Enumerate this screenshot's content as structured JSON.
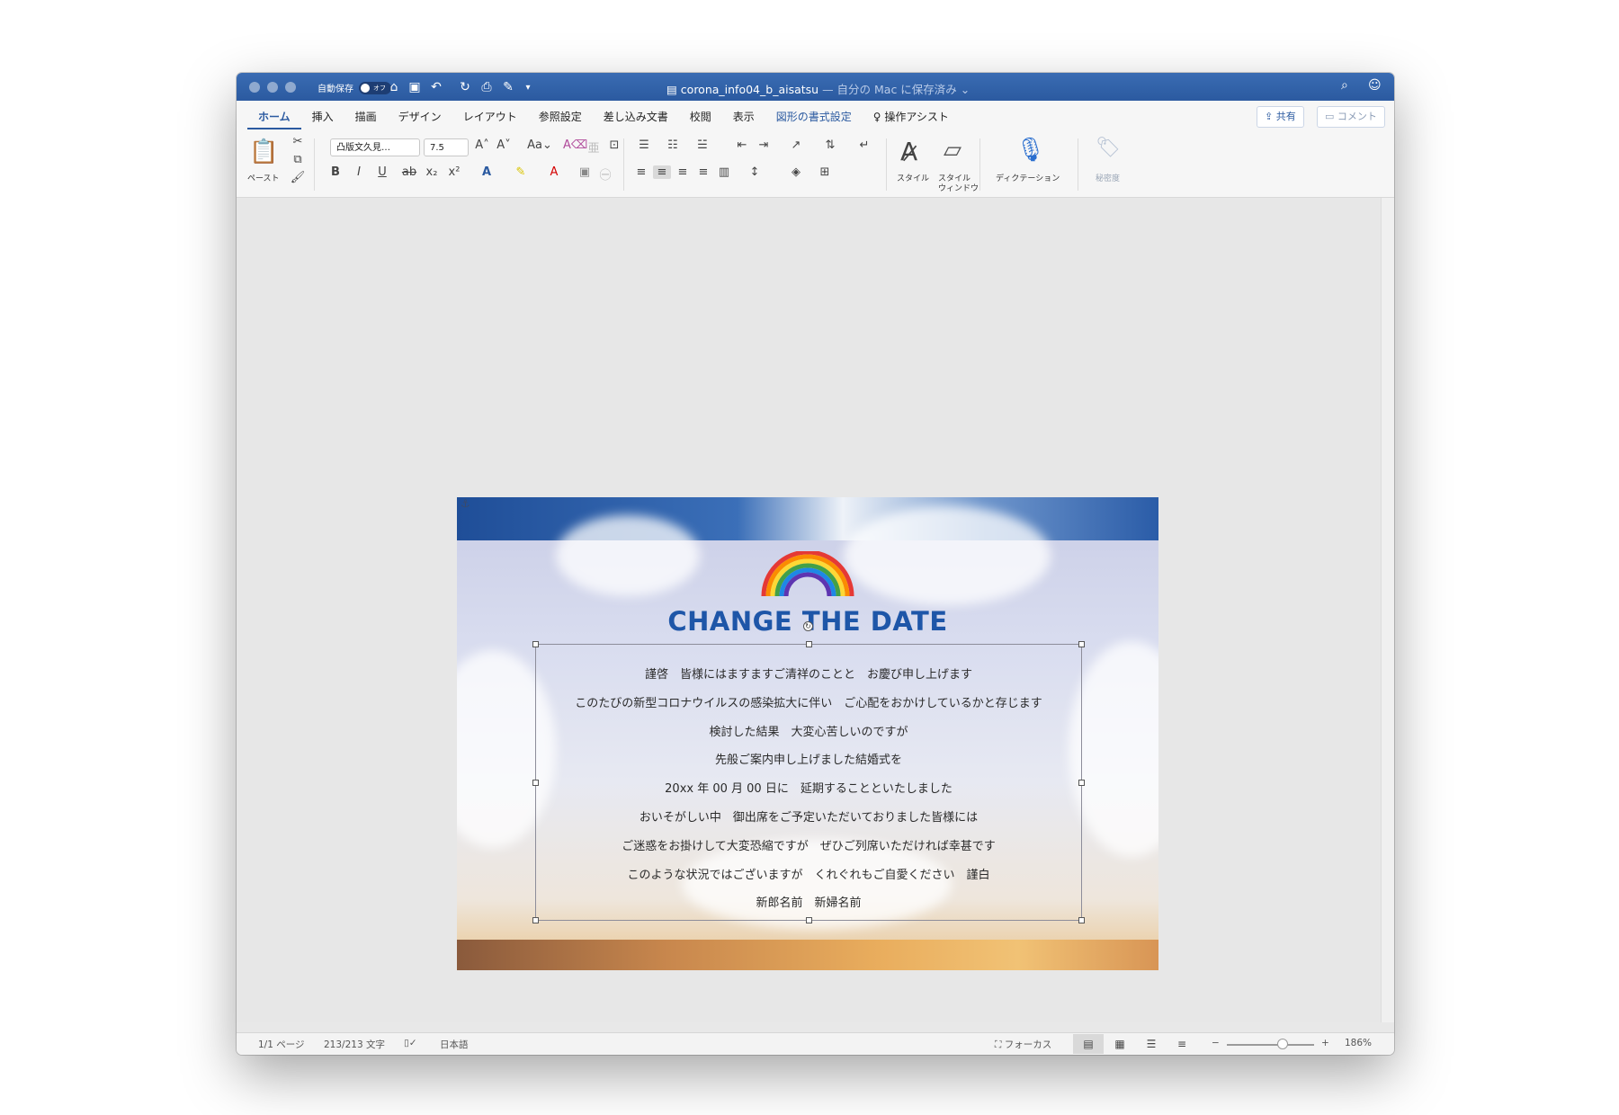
{
  "window": {
    "autosave_label": "自動保存",
    "autosave_state": "オフ",
    "document_name": "corona_info04_b_aisatsu",
    "document_status": " — 自分の Mac に保存済み ⌄"
  },
  "ribbon": {
    "tabs": [
      "ホーム",
      "挿入",
      "描画",
      "デザイン",
      "レイアウト",
      "参照設定",
      "差し込み文書",
      "校閲",
      "表示",
      "図形の書式設定"
    ],
    "assist": "操作アシスト",
    "share": "共有",
    "comment": "コメント",
    "paste": "ペースト",
    "font_name": "凸版文久見…",
    "font_size": "7.5",
    "styles": "スタイル",
    "style_window_1": "スタイル",
    "style_window_2": "ウィンドウ",
    "dictation": "ディクテーション",
    "sensitivity": "秘密度"
  },
  "card": {
    "title": "CHANGE THE DATE",
    "lines": [
      "謹啓　皆様にはますますご清祥のことと　お慶び申し上げます",
      "このたびの新型コロナウイルスの感染拡大に伴い　ご心配をおかけしているかと存じます",
      "検討した結果　大変心苦しいのですが",
      "先般ご案内申し上げました結婚式を",
      "20xx 年 00 月 00 日に　延期することといたしました",
      "おいそがしい中　御出席をご予定いただいておりました皆様には",
      "ご迷惑をお掛けして大変恐縮ですが　ぜひご列席いただければ幸甚です",
      "このような状況ではございますが　くれぐれもご自愛ください　謹白",
      "新郎名前　新婦名前"
    ]
  },
  "status": {
    "page": "1/1 ページ",
    "words": "213/213 文字",
    "language": "日本語",
    "focus": "フォーカス",
    "zoom": "186%"
  },
  "colors": {
    "titlebar": "#2b5aa0",
    "accent": "#2b5aa0",
    "card_title": "#1e56a8"
  }
}
